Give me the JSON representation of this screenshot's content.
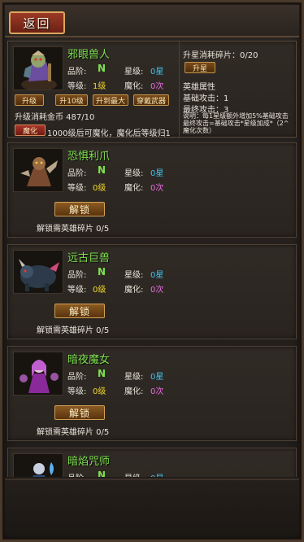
{
  "header": {
    "back_label": "返回"
  },
  "labels": {
    "grade": "品阶:",
    "star": "星级:",
    "level": "等级:",
    "magic": "魔化:",
    "unlock_btn": "解锁",
    "unlock_req": "解锁需英雄碎片 0/5"
  },
  "selected": {
    "name": "邪眼兽人",
    "grade_value": "N",
    "star_value": "0星",
    "level_value": "1级",
    "magic_value": "0次",
    "buttons": {
      "upgrade": "升级",
      "upgrade10": "升10级",
      "upgrade_max": "升到最大",
      "equip": "穿戴武器"
    },
    "upgrade_cost": "升级消耗金币 487/10",
    "magic_btn": "魔化",
    "magic_note": "1000级后可魔化，魔化后等级归1",
    "side": {
      "star_cost": "升星消耗碎片：0/20",
      "star_btn": "升星",
      "attr_title": "英雄属性",
      "base_atk": "基础攻击：1",
      "final_atk": "最终攻击：3",
      "note_line1": "说明：每1星级额外增加5%基础攻击",
      "note_line2": "最终攻击=基础攻击*星级加成*（2^",
      "note_line3": "魔化次数）"
    }
  },
  "heroes": [
    {
      "name": "恐惧利爪",
      "grade_value": "N",
      "star_value": "0星",
      "level_value": "0级",
      "magic_value": "0次"
    },
    {
      "name": "远古巨兽",
      "grade_value": "N",
      "star_value": "0星",
      "level_value": "0级",
      "magic_value": "0次"
    },
    {
      "name": "暗夜魔女",
      "grade_value": "N",
      "star_value": "0星",
      "level_value": "0级",
      "magic_value": "0次"
    },
    {
      "name": "暗焰咒师",
      "grade_value": "N",
      "star_value": "0星"
    }
  ],
  "colors": {
    "name_green": "#7ee04f",
    "star_blue": "#3fc4f0",
    "level_yellow": "#f0d52a",
    "magic_pink": "#e86be0"
  }
}
